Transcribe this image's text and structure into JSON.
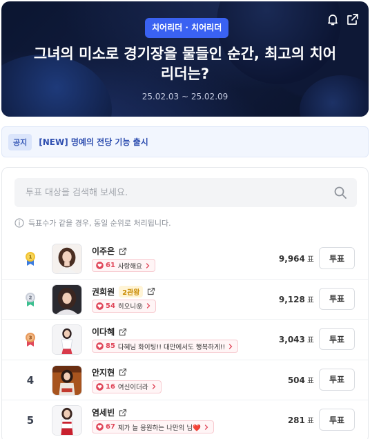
{
  "hero": {
    "category": "치어리더 · 치어리더",
    "title": "그녀의 미소로 경기장을 물들인 순간, 최고의 치어리더는?",
    "dates": "25.02.03 ~ 25.02.09",
    "icons": [
      "bell-icon",
      "share-icon"
    ]
  },
  "notice": {
    "tag": "공지",
    "text": "[NEW] 명예의 전당 기능 출시"
  },
  "search": {
    "placeholder": "투표 대상을 검색해 보세요."
  },
  "info": "득표수가 같을 경우, 동일 순위로 처리됩니다.",
  "candidates": [
    {
      "rank": "1",
      "medal": "gold",
      "name": "이주은",
      "badge": "",
      "cheer_count": "61",
      "cheer_text": "사랑해요",
      "votes": "9,964",
      "unit": "표",
      "vote_label": "투표"
    },
    {
      "rank": "2",
      "medal": "silver",
      "name": "권희원",
      "badge": "2관왕",
      "cheer_count": "54",
      "cheer_text": "히오니😝",
      "votes": "9,128",
      "unit": "표",
      "vote_label": "투표"
    },
    {
      "rank": "3",
      "medal": "bronze",
      "name": "이다혜",
      "badge": "",
      "cheer_count": "85",
      "cheer_text": "다혜님 화이팅!! 대만에서도 행복하게!!",
      "votes": "3,043",
      "unit": "표",
      "vote_label": "투표"
    },
    {
      "rank": "4",
      "medal": "",
      "name": "안지현",
      "badge": "",
      "cheer_count": "16",
      "cheer_text": "여신이더라",
      "votes": "504",
      "unit": "표",
      "vote_label": "투표"
    },
    {
      "rank": "5",
      "medal": "",
      "name": "염세빈",
      "badge": "",
      "cheer_count": "67",
      "cheer_text": "제가 늘 응원하는 나만의 님❤️",
      "votes": "281",
      "unit": "표",
      "vote_label": "투표"
    }
  ],
  "colors": {
    "accent": "#3a62f2",
    "heart": "#e0475a",
    "gold": "#f2c230",
    "silver": "#c9ced8",
    "bronze": "#e89a5c"
  }
}
